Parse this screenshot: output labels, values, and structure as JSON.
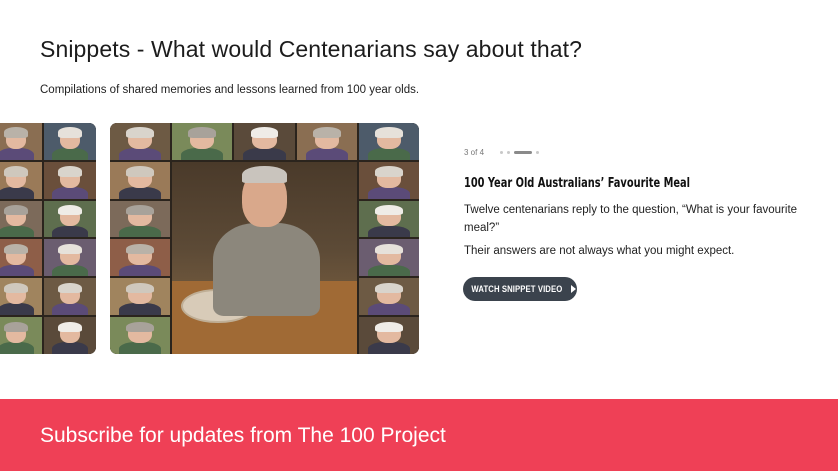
{
  "header": {
    "title": "Snippets - What would Centenarians say about that?",
    "subtitle": "Compilations of shared memories and lessons learned from 100 year olds."
  },
  "carousel": {
    "counter": "3 of 4",
    "current": 3,
    "total": 4,
    "slide": {
      "title": "100 Year Old Australians’ Favourite Meal",
      "description": "Twelve centenarians reply to the question, “What is your favourite meal?”",
      "note": "Their answers are not always what you might expect.",
      "button_label": "WATCH SNIPPET VIDEO",
      "button_icon": "play-icon"
    }
  },
  "subscribe": {
    "text": "Subscribe for updates from The 100 Project",
    "background": "#ef4056"
  },
  "colors": {
    "button": "#3b434d",
    "accent": "#ef4056"
  }
}
